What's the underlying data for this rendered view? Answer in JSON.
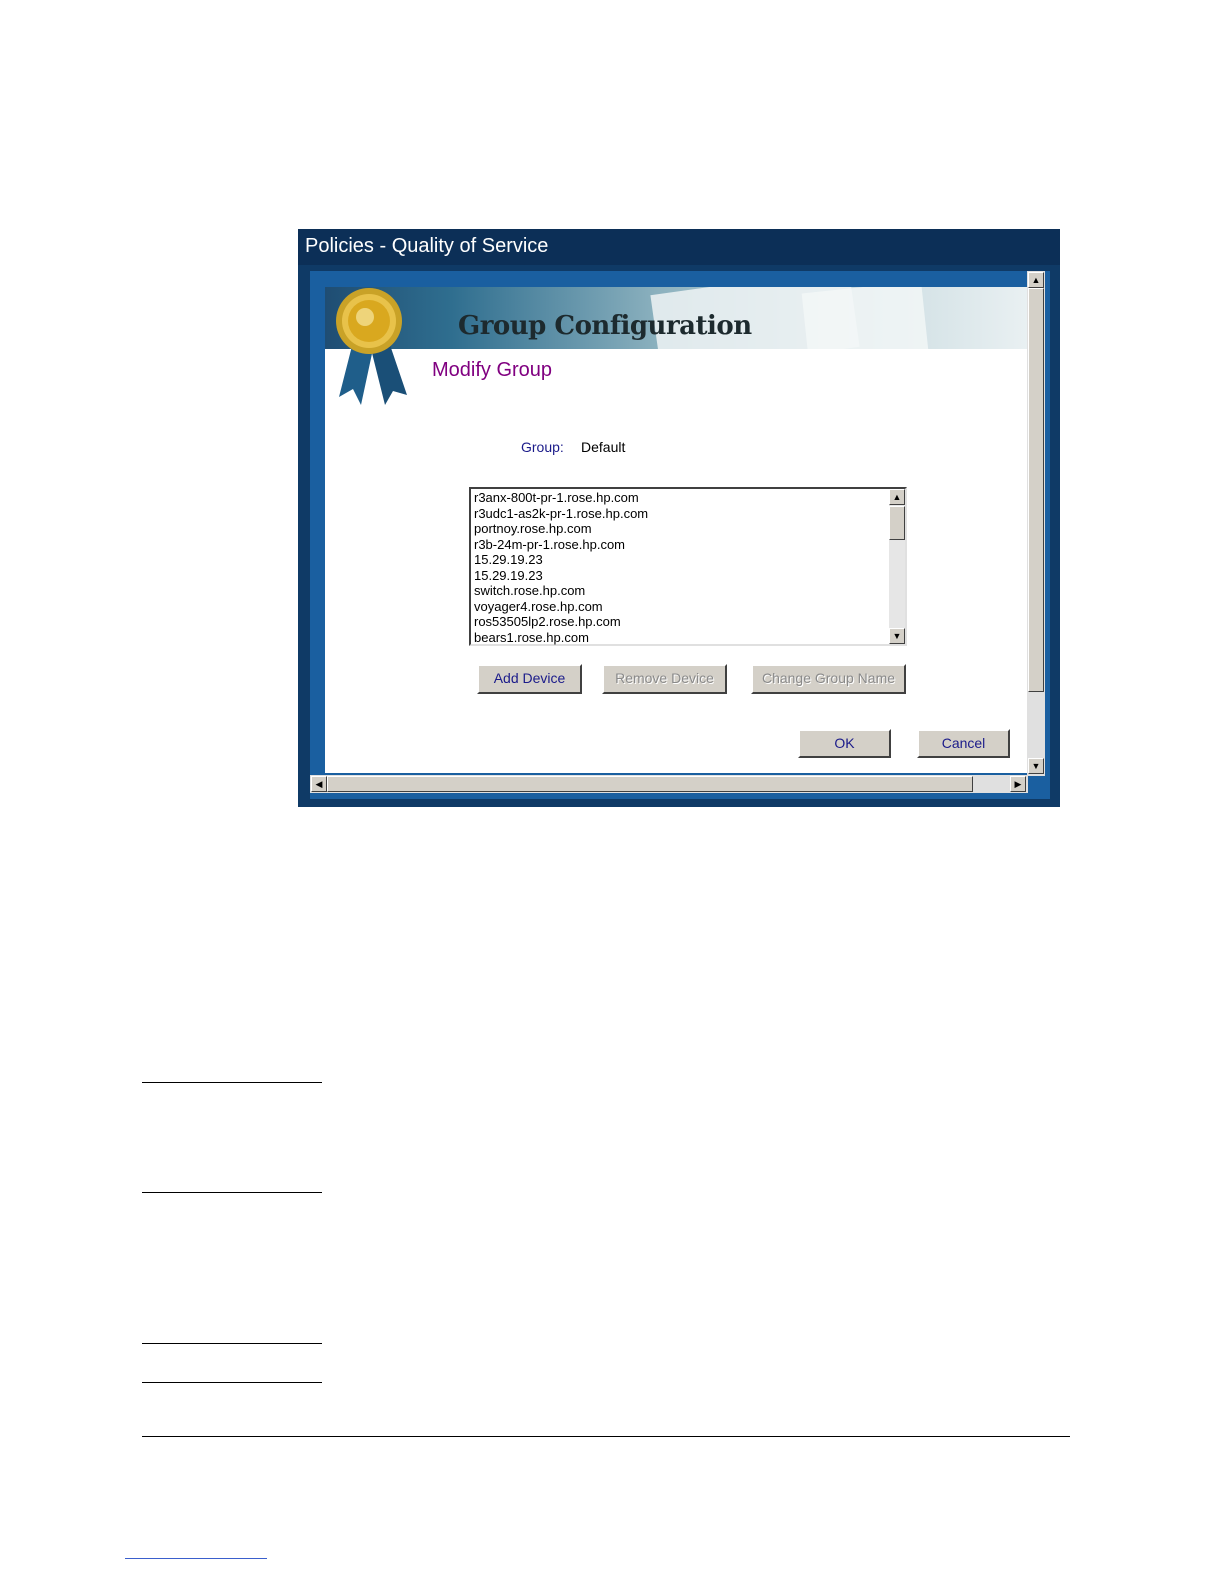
{
  "window": {
    "title": "Policies - Quality of Service"
  },
  "header": {
    "banner_title": "Group Configuration",
    "subtitle": "Modify Group"
  },
  "group": {
    "label": "Group:",
    "value": "Default"
  },
  "devices": [
    "r3anx-800t-pr-1.rose.hp.com",
    "r3udc1-as2k-pr-1.rose.hp.com",
    "portnoy.rose.hp.com",
    "r3b-24m-pr-1.rose.hp.com",
    "15.29.19.23",
    "15.29.19.23",
    "switch.rose.hp.com",
    "voyager4.rose.hp.com",
    "ros53505lp2.rose.hp.com",
    "bears1.rose.hp.com"
  ],
  "buttons": {
    "add_device": "Add Device",
    "remove_device": "Remove Device",
    "change_group_name": "Change Group Name",
    "ok": "OK",
    "cancel": "Cancel"
  },
  "icons": {
    "up": "scroll-up-arrow",
    "down": "scroll-down-arrow",
    "left": "scroll-left-arrow",
    "right": "scroll-right-arrow",
    "ribbon": "award-ribbon"
  }
}
